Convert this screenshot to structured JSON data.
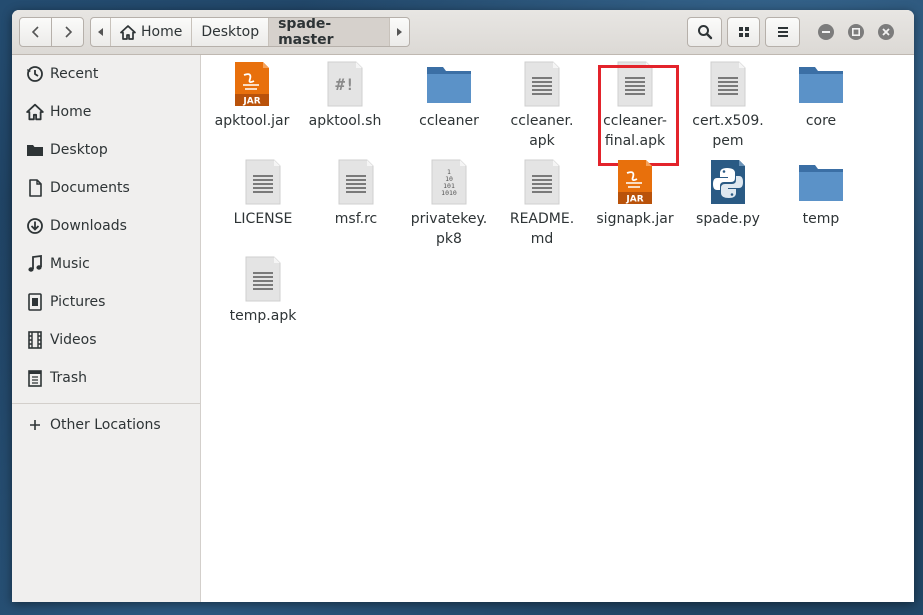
{
  "nav": {
    "back_icon": "chevron-left-icon",
    "forward_icon": "chevron-right-icon"
  },
  "path": {
    "items": [
      "Home",
      "Desktop",
      "spade-master"
    ],
    "home_icon": "home-icon"
  },
  "toolbar": {
    "search_icon": "search-icon",
    "view_icon": "grid-view-icon",
    "menu_icon": "hamburger-menu-icon"
  },
  "window_controls": [
    "minimize",
    "maximize",
    "close"
  ],
  "sidebar": {
    "items": [
      {
        "label": "Recent",
        "icon": "clock-icon"
      },
      {
        "label": "Home",
        "icon": "home-icon"
      },
      {
        "label": "Desktop",
        "icon": "folder-icon"
      },
      {
        "label": "Documents",
        "icon": "document-icon"
      },
      {
        "label": "Downloads",
        "icon": "download-icon"
      },
      {
        "label": "Music",
        "icon": "music-icon"
      },
      {
        "label": "Pictures",
        "icon": "picture-icon"
      },
      {
        "label": "Videos",
        "icon": "video-icon"
      },
      {
        "label": "Trash",
        "icon": "trash-icon"
      },
      {
        "label": "Other Locations",
        "icon": "plus-icon"
      }
    ]
  },
  "files": [
    {
      "name": "apktool.jar",
      "type": "jar"
    },
    {
      "name": "apktool.sh",
      "type": "script"
    },
    {
      "name": "ccleaner",
      "type": "folder"
    },
    {
      "name": "ccleaner.\napk",
      "type": "text"
    },
    {
      "name": "ccleaner-\nfinal.apk",
      "type": "text",
      "highlighted": true
    },
    {
      "name": "cert.x509.\npem",
      "type": "text"
    },
    {
      "name": "core",
      "type": "folder"
    },
    {
      "name": "LICENSE",
      "type": "text"
    },
    {
      "name": "msf.rc",
      "type": "text"
    },
    {
      "name": "privatekey.\npk8",
      "type": "binary"
    },
    {
      "name": "README.\nmd",
      "type": "text"
    },
    {
      "name": "signapk.jar",
      "type": "jar"
    },
    {
      "name": "spade.py",
      "type": "python"
    },
    {
      "name": "temp",
      "type": "folder"
    },
    {
      "name": "temp.apk",
      "type": "text"
    }
  ],
  "icon_glyphs": {
    "jar_label": "JAR",
    "script_label": "#!",
    "binary_label": "1\n10\n101\n1010"
  },
  "colors": {
    "highlight_border": "#e3232b",
    "folder": "#4a7fb5",
    "jar": "#e8700c"
  }
}
